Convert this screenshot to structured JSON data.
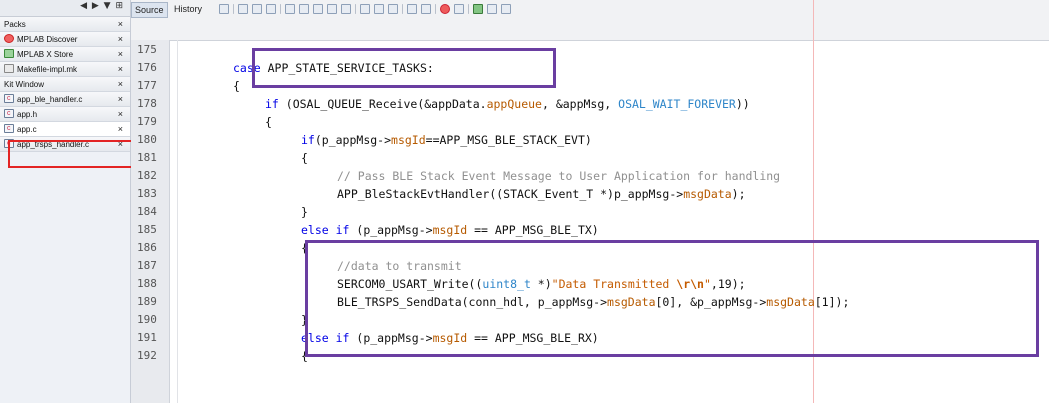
{
  "left_pane": {
    "controls": "◀ ▶ ▼ ⊞",
    "items": [
      {
        "label": "Packs",
        "icon": "none"
      },
      {
        "label": "MPLAB Discover",
        "icon": "discover-icon"
      },
      {
        "label": "MPLAB X Store",
        "icon": "store-icon"
      },
      {
        "label": "Makefile-impl.mk",
        "icon": "makefile-icon"
      },
      {
        "label": "Kit Window",
        "icon": "none"
      },
      {
        "label": "app_ble_handler.c",
        "icon": "c-file-icon"
      },
      {
        "label": "app.h",
        "icon": "h-file-icon"
      },
      {
        "label": "app.c",
        "icon": "c-file-icon"
      },
      {
        "label": "app_trsps_handler.c",
        "icon": "c-file-icon"
      }
    ],
    "close_glyph": "×"
  },
  "editor": {
    "tabs": {
      "source": "Source",
      "history": "History"
    },
    "line_numbers": [
      "175",
      "176",
      "177",
      "178",
      "179",
      "180",
      "181",
      "182",
      "183",
      "184",
      "185",
      "186",
      "187",
      "188",
      "189",
      "190",
      "191",
      "192"
    ]
  },
  "code": {
    "l176": {
      "kw": "case",
      "rest": " APP_STATE_SERVICE_TASKS:"
    },
    "l177": "{",
    "l178": {
      "kw": "if",
      "a": " (OSAL_QUEUE_Receive(&appData.",
      "field": "appQueue",
      "b": ", &appMsg, ",
      "const": "OSAL_WAIT_FOREVER",
      "c": "))"
    },
    "l179": "{",
    "l180": {
      "kw": "if",
      "a": "(p_appMsg->",
      "field": "msgId",
      "b": "==APP_MSG_BLE_STACK_EVT)"
    },
    "l181": "{",
    "l182": "// Pass BLE Stack Event Message to User Application for handling",
    "l183": {
      "a": "APP_BleStackEvtHandler((STACK_Event_T *)p_appMsg->",
      "field": "msgData",
      "b": ");"
    },
    "l184": "}",
    "l185": {
      "kw": "else if",
      "a": " (p_appMsg->",
      "field": "msgId",
      "b": " == APP_MSG_BLE_TX)"
    },
    "l186": "{",
    "l187": "//data to transmit",
    "l188": {
      "a": "SERCOM0_USART_Write((",
      "type": "uint8_t",
      "b": " *)",
      "str1": "\"Data Transmitted ",
      "esc": "\\r\\n",
      "str2": "\"",
      "c": ",19);"
    },
    "l189": {
      "a": "BLE_TRSPS_SendData(conn_hdl, p_appMsg->",
      "f1": "msgData",
      "b": "[0], &p_appMsg->",
      "f2": "msgData",
      "c": "[1]);"
    },
    "l190": "}",
    "l191": {
      "kw": "else if",
      "a": " (p_appMsg->",
      "field": "msgId",
      "b": " == APP_MSG_BLE_RX)"
    },
    "l192": "{"
  }
}
